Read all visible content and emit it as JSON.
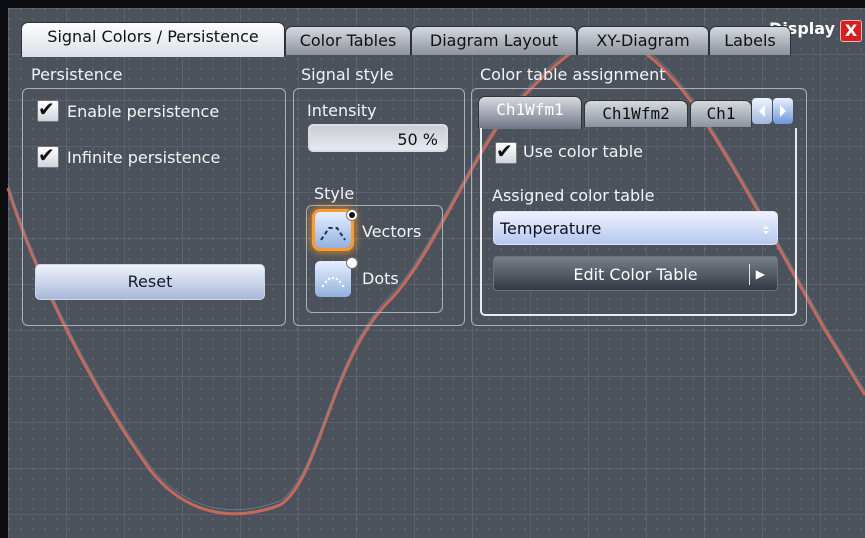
{
  "window": {
    "title": "Display",
    "close_label": "X"
  },
  "tabs": [
    {
      "label": "Signal Colors / Persistence"
    },
    {
      "label": "Color Tables"
    },
    {
      "label": "Diagram Layout"
    },
    {
      "label": "XY-Diagram"
    },
    {
      "label": "Labels"
    }
  ],
  "persistence": {
    "title": "Persistence",
    "enable_label": "Enable persistence",
    "infinite_label": "Infinite persistence",
    "reset_label": "Reset"
  },
  "signal_style": {
    "title": "Signal style",
    "intensity_label": "Intensity",
    "intensity_value": "50 %",
    "style_label": "Style",
    "vectors_label": "Vectors",
    "dots_label": "Dots",
    "selected_style": "Vectors"
  },
  "color_table": {
    "title": "Color table assignment",
    "subtabs": [
      {
        "label": "Ch1Wfm1"
      },
      {
        "label": "Ch1Wfm2"
      },
      {
        "label": "Ch1"
      }
    ],
    "use_label": "Use color table",
    "assigned_label": "Assigned color table",
    "assigned_value": "Temperature",
    "edit_label": "Edit Color Table"
  },
  "colors": {
    "waveform": "#c7685a",
    "dialog_border": "#aab0b8",
    "selected_glow": "#ff9a2e",
    "close_red": "#d62020"
  }
}
